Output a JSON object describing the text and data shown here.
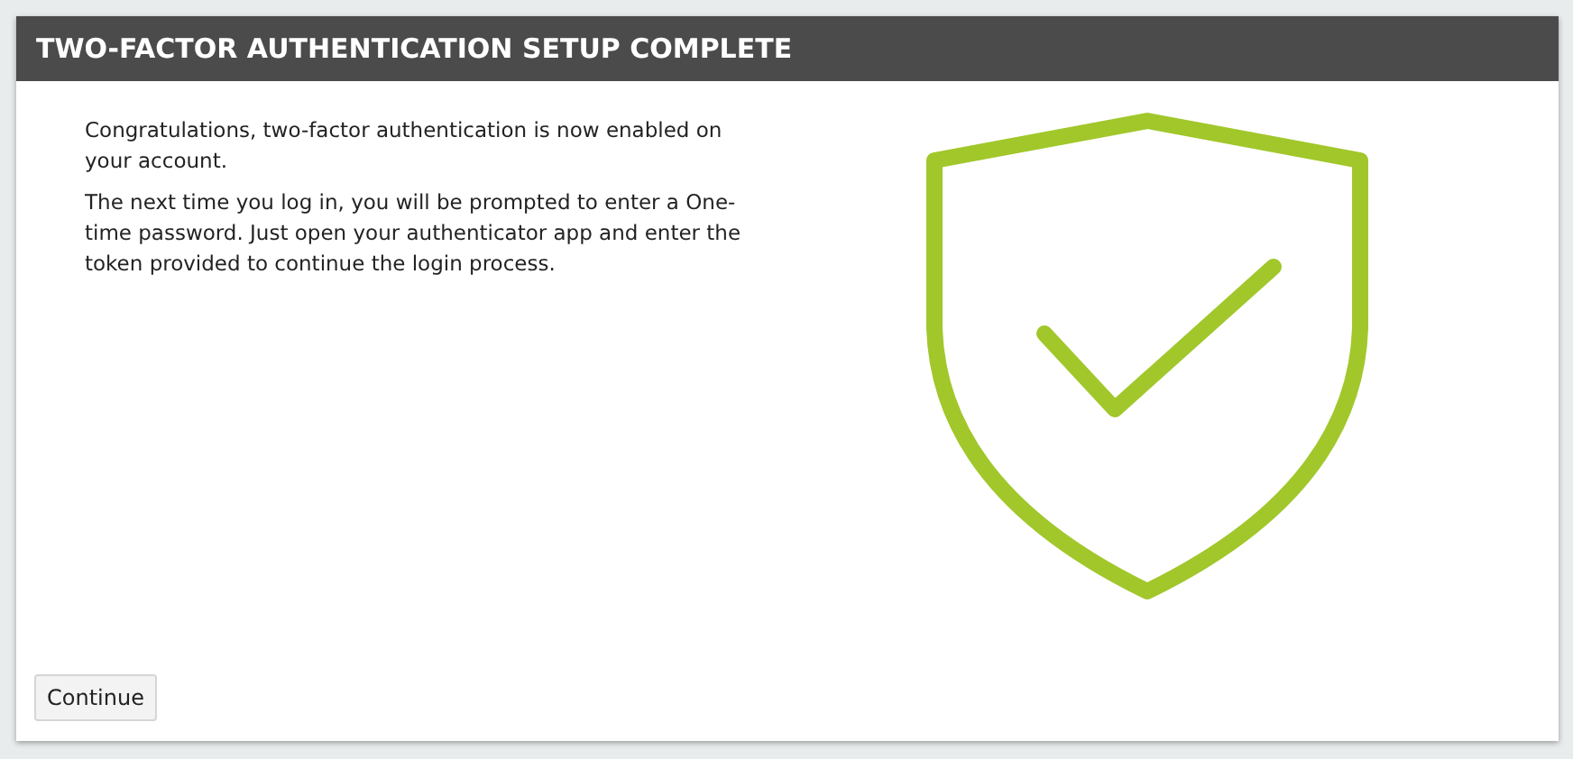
{
  "dialog": {
    "title": "TWO-FACTOR AUTHENTICATION SETUP COMPLETE",
    "paragraphs": [
      "Congratulations, two-factor authentication is now enabled on your account.",
      "The next time you log in, you will be prompted to enter a One-time password. Just open your authenticator app and enter the token provided to continue the login process."
    ],
    "buttons": [
      "Continue"
    ]
  }
}
